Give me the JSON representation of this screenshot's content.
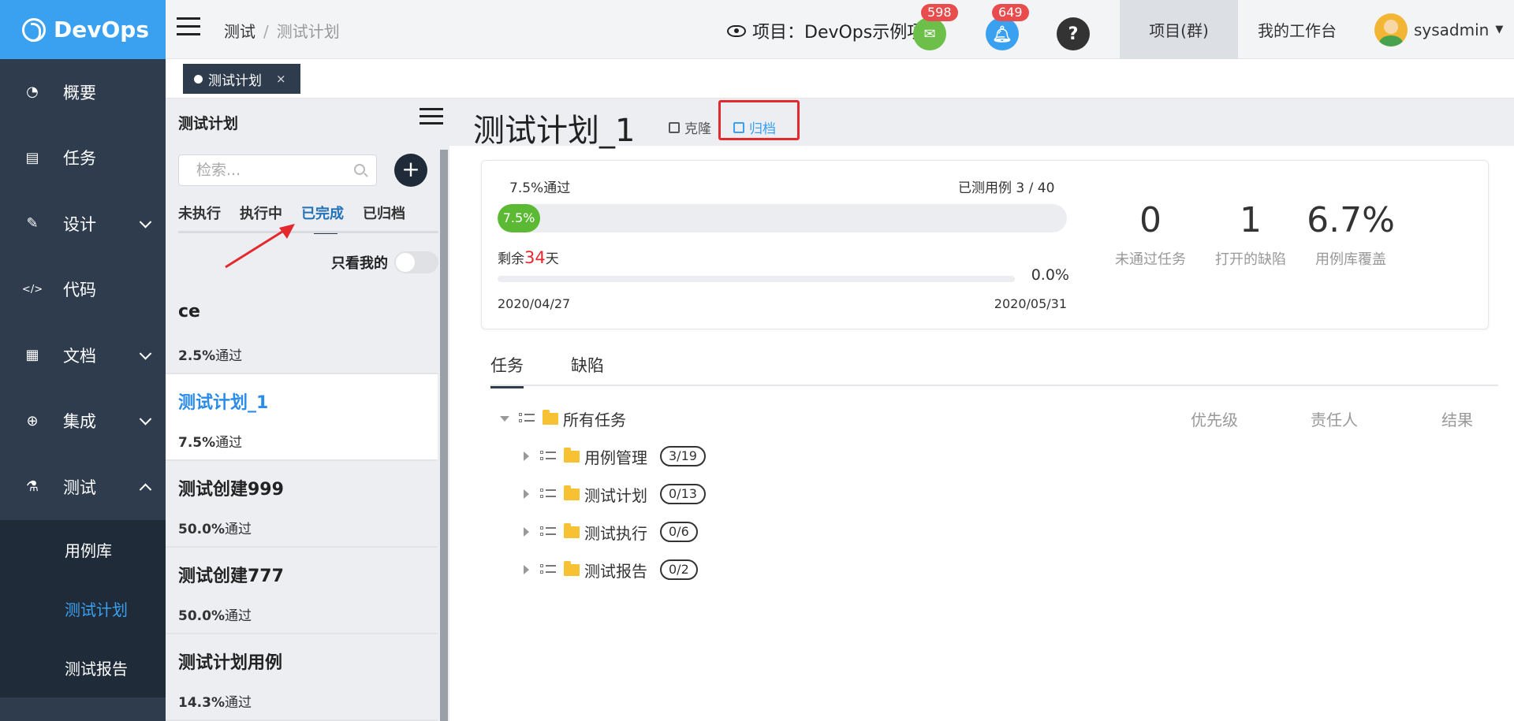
{
  "app": {
    "brand": "DevOps"
  },
  "sidebar": {
    "items": [
      {
        "label": "概要",
        "icon": "dashboard-icon"
      },
      {
        "label": "任务",
        "icon": "task-icon"
      },
      {
        "label": "设计",
        "icon": "design-icon"
      },
      {
        "label": "代码",
        "icon": "code-icon"
      },
      {
        "label": "文档",
        "icon": "document-icon"
      },
      {
        "label": "集成",
        "icon": "integration-icon"
      },
      {
        "label": "测试",
        "icon": "flask-icon"
      }
    ],
    "sub_items": [
      {
        "label": "用例库"
      },
      {
        "label": "测试计划"
      },
      {
        "label": "测试报告"
      }
    ]
  },
  "header": {
    "breadcrumb": [
      "测试",
      "测试计划"
    ],
    "project": "项目：DevOps示例项目",
    "badges": {
      "messages": "598",
      "notifications": "649"
    },
    "help": "?",
    "tabs": [
      "项目(群)",
      "我的工作台"
    ],
    "user": "sysadmin"
  },
  "open_tabs": [
    {
      "label": "测试计划",
      "close": "×"
    }
  ],
  "list_panel": {
    "title": "测试计划",
    "search_placeholder": "检索...",
    "add": "+",
    "filters": [
      "未执行",
      "执行中",
      "已完成",
      "已归档"
    ],
    "only_mine": "只看我的",
    "plans": [
      {
        "name": "ce",
        "pct": "2.5%",
        "pass_suffix": "通过"
      },
      {
        "name": "测试计划_1",
        "pct": "7.5%",
        "pass_suffix": "通过"
      },
      {
        "name": "测试创建999",
        "pct": "50.0%",
        "pass_suffix": "通过"
      },
      {
        "name": "测试创建777",
        "pct": "50.0%",
        "pass_suffix": "通过"
      },
      {
        "name": "测试计划用例",
        "pct": "14.3%",
        "pass_suffix": "通过"
      }
    ]
  },
  "plan_detail": {
    "title": "测试计划_1",
    "clone": "克隆",
    "archive": "归档",
    "pass_label": "7.5%通过",
    "tested_cases": "已测用例 3 / 40",
    "progress_pct_text": "7.5%",
    "progress_value": 0.075,
    "remain_prefix": "剩余",
    "remain_days": "34",
    "remain_suffix": "天",
    "time_pct_text": "0.0%",
    "time_value": 0.0,
    "start_date": "2020/04/27",
    "end_date": "2020/05/31",
    "stats": [
      {
        "value": "0",
        "label": "未通过任务"
      },
      {
        "value": "1",
        "label": "打开的缺陷"
      },
      {
        "value": "6.7%",
        "label": "用例库覆盖"
      }
    ]
  },
  "detail_tabs": [
    "任务",
    "缺陷"
  ],
  "tree": {
    "root": "所有任务",
    "columns": [
      "优先级",
      "责任人",
      "结果"
    ],
    "children": [
      {
        "label": "用例管理",
        "count": "3/19"
      },
      {
        "label": "测试计划",
        "count": "0/13"
      },
      {
        "label": "测试执行",
        "count": "0/6"
      },
      {
        "label": "测试报告",
        "count": "0/2"
      }
    ]
  },
  "colors": {
    "brand": "#3aa0f0",
    "nav_bg": "#2e3c4e",
    "pass_green": "#5cb934",
    "alert_red": "#e4292e"
  }
}
